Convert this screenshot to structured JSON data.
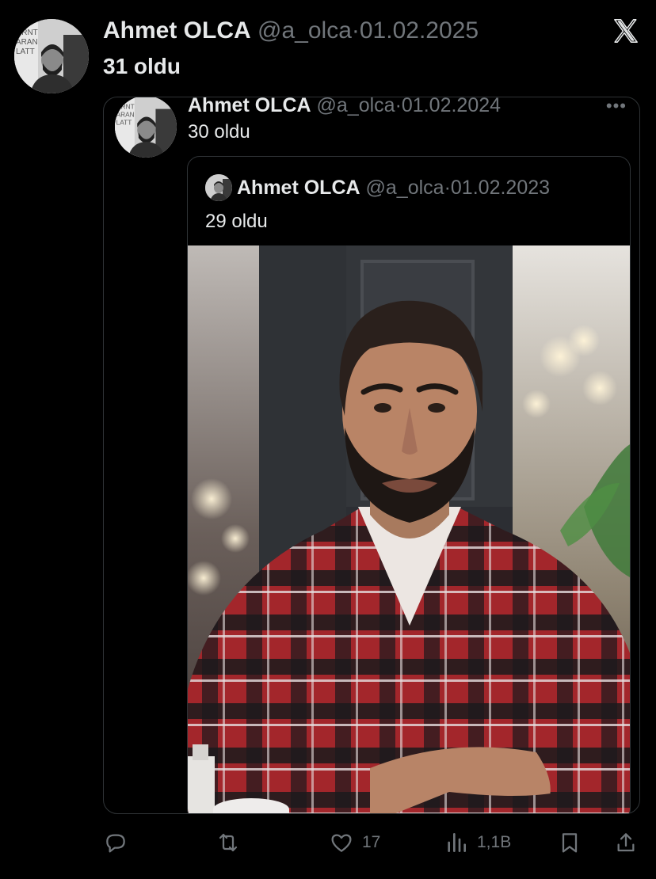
{
  "tweet": {
    "author_name": "Ahmet OLCA",
    "handle": "@a_olca",
    "separator": "·",
    "date": "01.02.2025",
    "text": "31 oldu",
    "avatar_sign_text": "URNT\nARAN\nLATT"
  },
  "quote1": {
    "author_name": "Ahmet OLCA",
    "handle": "@a_olca",
    "separator": "·",
    "date": "01.02.2024",
    "text": "30 oldu",
    "more_label": "•••",
    "avatar_sign_text": "URNT\nARAN\nLATT"
  },
  "quote2": {
    "author_name": "Ahmet OLCA",
    "handle": "@a_olca",
    "separator": "·",
    "date": "01.02.2023",
    "text": "29 oldu"
  },
  "actions": {
    "reply": {
      "icon": "reply-icon",
      "count": ""
    },
    "retweet": {
      "icon": "retweet-icon",
      "count": ""
    },
    "like": {
      "icon": "heart-icon",
      "count": "17"
    },
    "views": {
      "icon": "views-chart-icon",
      "count": "1,1B"
    },
    "bookmark": {
      "icon": "bookmark-icon",
      "count": ""
    },
    "share": {
      "icon": "share-icon",
      "count": ""
    }
  },
  "colors": {
    "background": "#000000",
    "primary_text": "#e7e9ea",
    "secondary_text": "#71767b",
    "border": "#2f3336"
  }
}
